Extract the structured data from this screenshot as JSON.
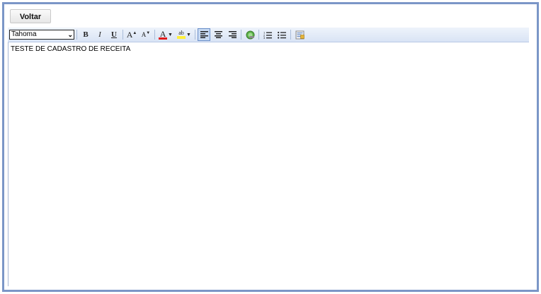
{
  "back_button": {
    "label": "Voltar"
  },
  "toolbar": {
    "font_family": "Tahoma",
    "bold_label": "B",
    "italic_label": "I",
    "underline_label": "U",
    "font_grow_label": "A",
    "font_shrink_label": "A",
    "font_color_label": "A",
    "highlight_label": "ab",
    "icons": [
      "bold-icon",
      "italic-icon",
      "underline-icon",
      "font-grow-icon",
      "font-shrink-icon",
      "font-color-icon",
      "highlight-icon",
      "align-left-icon",
      "align-center-icon",
      "align-right-icon",
      "insert-link-icon",
      "ordered-list-icon",
      "unordered-list-icon",
      "html-source-icon"
    ],
    "accent_colors": {
      "font_color": "#e01919",
      "highlight": "#ffef3a",
      "toolbar_active": "#c8daf2"
    }
  },
  "editor": {
    "content": "TESTE DE CADASTRO DE RECEITA"
  }
}
